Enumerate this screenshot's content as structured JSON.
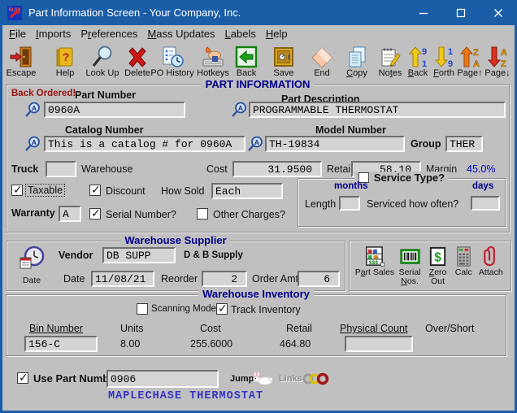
{
  "window": {
    "title": "Part Information Screen - Your Company, Inc.",
    "app_icon": "blss-logo-icon",
    "controls": [
      "minimize",
      "maximize",
      "close"
    ]
  },
  "colors": {
    "titlebar": "#1b5ea8",
    "window_bg": "#c0c0c0",
    "section_title": "#00008b",
    "back_ordered": "#9c1414",
    "margin_value": "#0000c8",
    "linked_part": "#3434c4",
    "field_bg": "#d4d4d4"
  },
  "menu": {
    "items": [
      {
        "label": "File",
        "u": 0
      },
      {
        "label": "Imports",
        "u": 0
      },
      {
        "label": "Preferences",
        "u": 1
      },
      {
        "label": "Mass Updates",
        "u": 0
      },
      {
        "label": "Labels",
        "u": 0
      },
      {
        "label": "Help",
        "u": 0
      }
    ]
  },
  "toolbar": {
    "buttons": [
      {
        "label": "Escape",
        "u": -1,
        "icon": "door-exit-icon"
      },
      {
        "label": "Help",
        "u": -1,
        "icon": "help-book-icon"
      },
      {
        "label": "Look Up",
        "u": -1,
        "icon": "magnifier-icon"
      },
      {
        "label": "Delete",
        "u": -1,
        "icon": "red-x-icon"
      },
      {
        "label": "PO History",
        "u": -1,
        "icon": "clipboard-clock-icon"
      },
      {
        "label": "Hotkeys",
        "u": -1,
        "icon": "keyboard-hand-icon"
      },
      {
        "label": "Back",
        "u": -1,
        "icon": "green-back-arrow-icon"
      },
      {
        "label": "Save",
        "u": -1,
        "icon": "safe-icon"
      },
      {
        "label": "End",
        "u": -1,
        "icon": "eraser-icon"
      },
      {
        "label": "Copy",
        "u": 0,
        "icon": "copy-documents-icon"
      },
      {
        "label": "Notes",
        "u": 2,
        "icon": "notepad-pencil-icon"
      },
      {
        "label": "Back",
        "u": 0,
        "icon": "record-back-arrow-icon"
      },
      {
        "label": "Forth",
        "u": 0,
        "icon": "record-forth-arrow-icon"
      },
      {
        "label": "Page↑",
        "u": -1,
        "icon": "page-up-arrow-icon"
      },
      {
        "label": "Page↓",
        "u": -1,
        "icon": "page-down-arrow-icon"
      }
    ]
  },
  "part_info": {
    "section_title": "PART INFORMATION",
    "back_ordered": "Back Ordered!",
    "part_number": {
      "label": "Part Number",
      "value": "0960A",
      "icon": "magnifier-a-icon"
    },
    "part_description": {
      "label": "Part Description",
      "value": "PROGRAMMABLE THERMOSTAT",
      "icon": "magnifier-a-icon"
    },
    "catalog_number": {
      "label": "Catalog Number",
      "value": "This is a catalog # for 0960A",
      "icon": "magnifier-a-icon"
    },
    "model_number": {
      "label": "Model Number",
      "value": "TH-19834",
      "icon": "magnifier-a-icon"
    },
    "group": {
      "label": "Group",
      "value": "THER"
    },
    "truck": {
      "label": "Truck",
      "value": ""
    },
    "warehouse_label": "Warehouse",
    "cost": {
      "label": "Cost",
      "value": "31.9500"
    },
    "retail": {
      "label": "Retail",
      "value": "58.10"
    },
    "margin": {
      "label": "Margin",
      "value": "45.0%"
    },
    "taxable": {
      "label": "Taxable",
      "checked": true
    },
    "discount": {
      "label": "Discount",
      "checked": true
    },
    "how_sold": {
      "label": "How Sold",
      "value": "Each"
    },
    "warranty": {
      "label": "Warranty",
      "value": "A"
    },
    "serial_number": {
      "label": "Serial Number?",
      "checked": true
    },
    "other_charges": {
      "label": "Other Charges?",
      "checked": false
    },
    "service_type": {
      "label": "Service Type?",
      "checked": false,
      "months_label": "months",
      "days_label": "days",
      "length": {
        "label": "Length",
        "value": ""
      },
      "serviced": {
        "label": "Serviced how often?",
        "value": ""
      }
    }
  },
  "supplier": {
    "section_title": "Warehouse Supplier",
    "date_button": {
      "label": "Date",
      "icon": "clock-calendar-icon"
    },
    "vendor": {
      "label": "Vendor",
      "value": "DB SUPP",
      "name": "D & B Supply"
    },
    "date": {
      "label": "Date",
      "value": "11/08/21"
    },
    "reorder": {
      "label": "Reorder",
      "value": "2"
    },
    "order_amt": {
      "label": "Order Amt",
      "value": "6"
    },
    "actions": [
      {
        "label": "Part Sales",
        "u": 1,
        "icon": "shelf-sales-icon"
      },
      {
        "label": "Serial Nos.",
        "u": 7,
        "icon": "barcode-icon"
      },
      {
        "label": "Zero Out",
        "u": 0,
        "icon": "dollar-box-icon"
      },
      {
        "label": "Calc",
        "u": -1,
        "icon": "calculator-icon"
      },
      {
        "label": "Attach",
        "u": -1,
        "icon": "paperclip-icon"
      }
    ]
  },
  "inventory": {
    "section_title": "Warehouse Inventory",
    "scanning_mode": {
      "label": "Scanning Mode",
      "checked": false
    },
    "track_inventory": {
      "label": "Track Inventory",
      "checked": true
    },
    "columns": [
      {
        "label": "Bin Number",
        "underlined": true
      },
      {
        "label": "Units",
        "underlined": false
      },
      {
        "label": "Cost",
        "underlined": false
      },
      {
        "label": "Retail",
        "underlined": false
      },
      {
        "label": "Physical Count",
        "underlined": true
      },
      {
        "label": "Over/Short",
        "underlined": false
      }
    ],
    "row": {
      "bin_number": "156-C",
      "units": "8.00",
      "cost": "255.6000",
      "retail": "464.80",
      "physical_count": "",
      "over_short": ""
    }
  },
  "footer": {
    "use_part_number": {
      "label": "Use Part Number",
      "checked": true,
      "value": "0906"
    },
    "jump": {
      "label": "Jump",
      "icon": "rabbit-icon"
    },
    "links": {
      "label": "Links",
      "icon": "chain-rings-icon"
    },
    "linked_part_description": "MAPLECHASE THERMOSTAT"
  }
}
